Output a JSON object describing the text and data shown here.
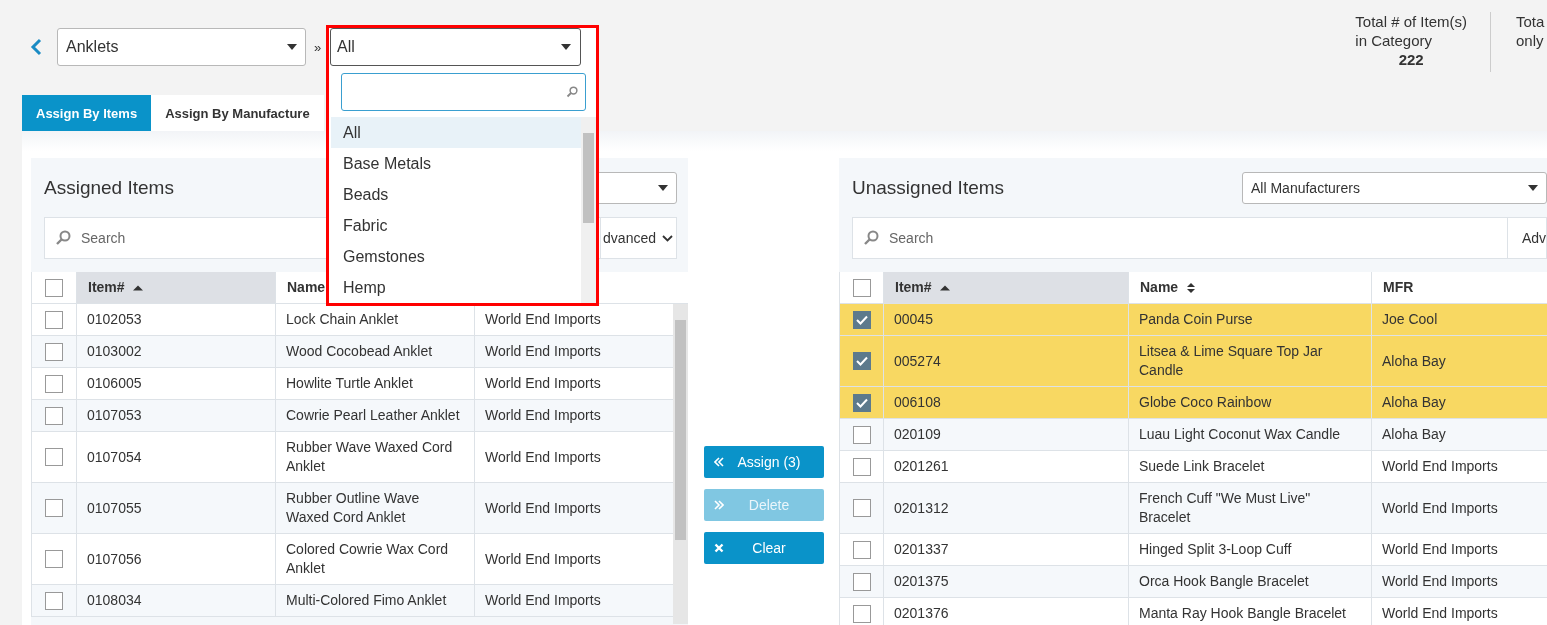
{
  "breadcrumb": {
    "category": "Anklets",
    "separator": "»",
    "subcategory": "All"
  },
  "dropdown": {
    "options": [
      {
        "label": "All",
        "selected": true
      },
      {
        "label": "Base Metals",
        "selected": false
      },
      {
        "label": "Beads",
        "selected": false
      },
      {
        "label": "Fabric",
        "selected": false
      },
      {
        "label": "Gemstones",
        "selected": false
      },
      {
        "label": "Hemp",
        "selected": false
      }
    ]
  },
  "stats": [
    {
      "lines": [
        "Total # of Item(s)",
        "in Category"
      ],
      "value": "222"
    },
    {
      "lines": [
        "Tota",
        "only"
      ]
    }
  ],
  "tabs": [
    {
      "label": "Assign By Items",
      "selected": true
    },
    {
      "label": "Assign By Manufacture",
      "selected": false
    }
  ],
  "assigned": {
    "title": "Assigned Items",
    "search_placeholder": "Search",
    "advanced": "dvanced",
    "select_all_checked": false,
    "columns": [
      {
        "label": "Item#",
        "sorted": true
      },
      {
        "label": "Name",
        "sorted": false
      }
    ],
    "rows": [
      {
        "item": "0102053",
        "name": "Lock Chain Anklet",
        "mfr": "World End Imports",
        "checked": false
      },
      {
        "item": "0103002",
        "name": "Wood Cocobead Anklet",
        "mfr": "World End Imports",
        "checked": false
      },
      {
        "item": "0106005",
        "name": "Howlite Turtle Anklet",
        "mfr": "World End Imports",
        "checked": false
      },
      {
        "item": "0107053",
        "name": "Cowrie Pearl Leather Anklet",
        "mfr": "World End Imports",
        "checked": false
      },
      {
        "item": "0107054",
        "name": "Rubber Wave Waxed Cord Anklet",
        "mfr": "World End Imports",
        "checked": false
      },
      {
        "item": "0107055",
        "name": "Rubber Outline Wave Waxed Cord Anklet",
        "mfr": "World End Imports",
        "checked": false
      },
      {
        "item": "0107056",
        "name": "Colored Cowrie Wax Cord Anklet",
        "mfr": "World End Imports",
        "checked": false
      },
      {
        "item": "0108034",
        "name": "Multi-Colored Fimo Anklet",
        "mfr": "World End Imports",
        "checked": false
      }
    ]
  },
  "actions": [
    {
      "kind": "assign",
      "label": "Assign (3)",
      "disabled": false
    },
    {
      "kind": "delete",
      "label": "Delete",
      "disabled": true
    },
    {
      "kind": "clear",
      "label": "Clear",
      "disabled": false
    }
  ],
  "unassigned": {
    "title": "Unassigned Items",
    "manufacturer": "All Manufacturers",
    "search_placeholder": "Search",
    "advanced": "Adv",
    "select_all_checked": false,
    "columns": [
      {
        "label": "Item#",
        "sorted": true
      },
      {
        "label": "Name",
        "sorted": false,
        "sortable": true
      },
      {
        "label": "MFR",
        "sorted": false,
        "sortable": false
      }
    ],
    "rows": [
      {
        "item": "00045",
        "name": "Panda Coin Purse",
        "mfr": "Joe Cool",
        "checked": true,
        "selected": true
      },
      {
        "item": "005274",
        "name": "Litsea & Lime Square Top Jar Candle",
        "mfr": "Aloha Bay",
        "checked": true,
        "selected": true
      },
      {
        "item": "006108",
        "name": "Globe Coco Rainbow",
        "mfr": "Aloha Bay",
        "checked": true,
        "selected": true
      },
      {
        "item": "020109",
        "name": "Luau Light Coconut Wax Candle",
        "mfr": "Aloha Bay",
        "checked": false,
        "selected": false
      },
      {
        "item": "0201261",
        "name": "Suede Link Bracelet",
        "mfr": "World End Imports",
        "checked": false,
        "selected": false
      },
      {
        "item": "0201312",
        "name": "French Cuff \"We Must Live\" Bracelet",
        "mfr": "World End Imports",
        "checked": false,
        "selected": false
      },
      {
        "item": "0201337",
        "name": "Hinged Split 3-Loop Cuff",
        "mfr": "World End Imports",
        "checked": false,
        "selected": false
      },
      {
        "item": "0201375",
        "name": "Orca Hook Bangle Bracelet",
        "mfr": "World End Imports",
        "checked": false,
        "selected": false
      },
      {
        "item": "0201376",
        "name": "Manta Ray Hook Bangle Bracelet",
        "mfr": "World End Imports",
        "checked": false,
        "selected": false
      }
    ]
  }
}
